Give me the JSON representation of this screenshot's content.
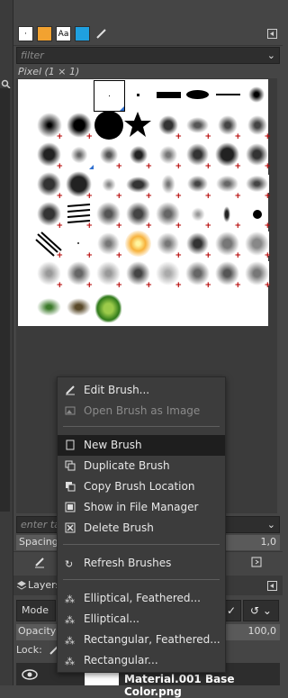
{
  "brushes_panel": {
    "filter_placeholder": "filter",
    "selected_brush_label": "Pixel (1 × 1)",
    "tag_placeholder": "enter ta",
    "spacing_label": "Spacing",
    "spacing_value": "1,0"
  },
  "tabs": [
    {
      "icon": "brushes-tab-icon",
      "glyph": "·"
    },
    {
      "icon": "patterns-tab-icon",
      "glyph": ""
    },
    {
      "icon": "fonts-tab-icon",
      "glyph": "Aa"
    },
    {
      "icon": "gradients-tab-icon",
      "glyph": ""
    },
    {
      "icon": "paint-dynamics-tab-icon",
      "glyph": ""
    }
  ],
  "layers_panel": {
    "tab_title": "Layers",
    "mode_label": "Mode",
    "opacity_label": "Opacity",
    "opacity_value": "100,0",
    "lock_label": "Lock:",
    "layer_name": "Material.001 Base Color.png"
  },
  "context_menu": {
    "items": [
      {
        "label": "Edit Brush...",
        "icon": "edit-brush-icon",
        "enabled": true
      },
      {
        "label": "Open Brush as Image",
        "icon": "open-as-image-icon",
        "enabled": false
      },
      {
        "label": "New Brush",
        "icon": "new-brush-icon",
        "enabled": true,
        "highlighted": true
      },
      {
        "label": "Duplicate Brush",
        "icon": "duplicate-icon",
        "enabled": true
      },
      {
        "label": "Copy Brush Location",
        "icon": "copy-location-icon",
        "enabled": true
      },
      {
        "label": "Show in File Manager",
        "icon": "file-manager-icon",
        "enabled": true
      },
      {
        "label": "Delete Brush",
        "icon": "delete-icon",
        "enabled": true
      },
      {
        "label": "Refresh Brushes",
        "icon": "refresh-icon",
        "enabled": true
      },
      {
        "label": "Elliptical, Feathered...",
        "icon": "elliptical-feathered-icon",
        "enabled": true
      },
      {
        "label": "Elliptical...",
        "icon": "elliptical-icon",
        "enabled": true
      },
      {
        "label": "Rectangular, Feathered...",
        "icon": "rectangular-feathered-icon",
        "enabled": true
      },
      {
        "label": "Rectangular...",
        "icon": "rectangular-icon",
        "enabled": true
      }
    ]
  },
  "colors": {
    "background": "#454545",
    "menu_bg": "#3c3c3c",
    "highlight": "#1e1e1e",
    "grid_bg": "#ffffff"
  }
}
